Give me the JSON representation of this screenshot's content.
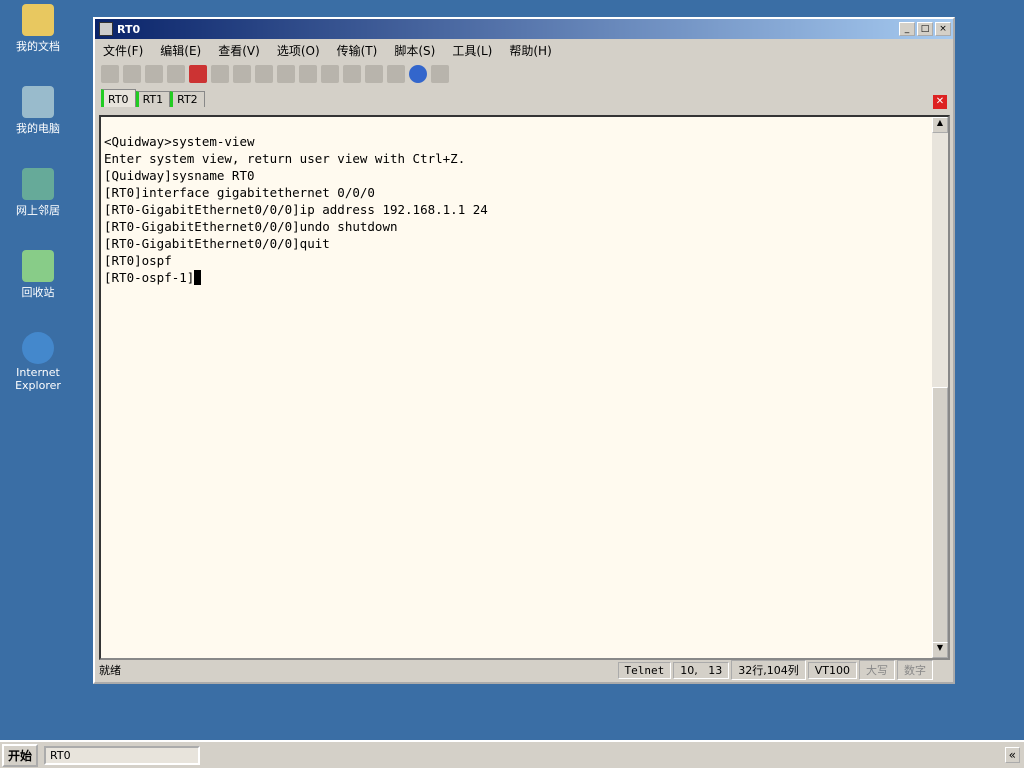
{
  "desktop": {
    "icons": [
      "我的文档",
      "我的电脑",
      "网上邻居",
      "回收站",
      "Internet Explorer"
    ]
  },
  "window": {
    "title": "RT0",
    "menu": [
      "文件(F)",
      "编辑(E)",
      "查看(V)",
      "选项(O)",
      "传输(T)",
      "脚本(S)",
      "工具(L)",
      "帮助(H)"
    ],
    "tabs": [
      "RT0",
      "RT1",
      "RT2"
    ],
    "terminal_lines": [
      "<Quidway>system-view",
      "Enter system view, return user view with Ctrl+Z.",
      "[Quidway]sysname RT0",
      "[RT0]interface gigabitethernet 0/0/0",
      "[RT0-GigabitEthernet0/0/0]ip address 192.168.1.1 24",
      "[RT0-GigabitEthernet0/0/0]undo shutdown",
      "[RT0-GigabitEthernet0/0/0]quit",
      "[RT0]ospf",
      "[RT0-ospf-1]"
    ],
    "status": {
      "ready": "就绪",
      "protocol": "Telnet",
      "pos": "10,   13",
      "size": "32行,104列",
      "term": "VT100",
      "caps": "大写",
      "num": "数字"
    }
  },
  "taskbar": {
    "start": "开始",
    "task": "RT0"
  }
}
